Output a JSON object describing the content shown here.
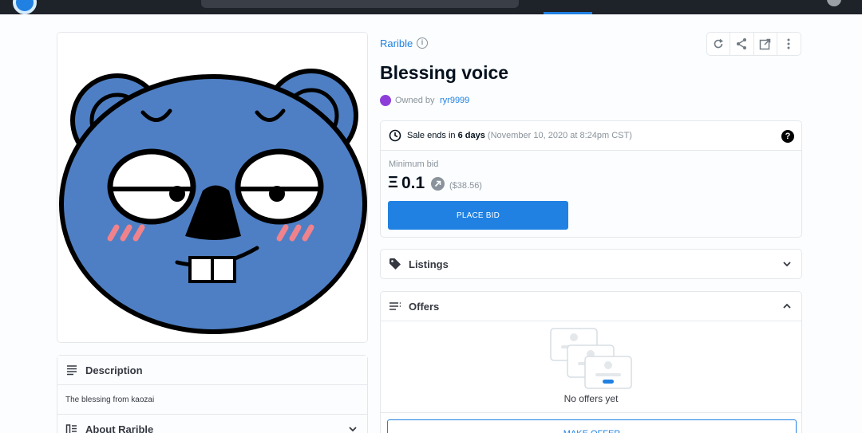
{
  "asset": {
    "collection": "Rarible",
    "title": "Blessing voice",
    "owned_by_label": "Owned by",
    "owner": "ryr9999"
  },
  "sale": {
    "ends_prefix": "Sale ends in",
    "ends_in": "6 days",
    "end_date": "(November 10, 2020 at 8:24pm CST)",
    "min_bid_label": "Minimum bid",
    "currency_symbol": "Ξ",
    "amount": "0.1",
    "usd": "($38.56)",
    "place_bid_label": "PLACE BID"
  },
  "listings": {
    "label": "Listings"
  },
  "offers": {
    "label": "Offers",
    "empty_text": "No offers yet",
    "make_offer_label": "MAKE OFFER"
  },
  "description": {
    "label": "Description",
    "text": "The blessing from kaozai"
  },
  "about": {
    "label": "About Rarible"
  },
  "colors": {
    "accent": "#2081e2",
    "character_blue": "#4e7fc4",
    "owner_avatar": "#8e3ed8",
    "blush": "#f0828c"
  },
  "icons": {
    "refresh": "refresh-icon",
    "share": "share-icon",
    "external": "external-link-icon",
    "more": "more-vertical-icon",
    "clock": "clock-icon",
    "help": "help-icon",
    "tag": "tag-icon",
    "list": "list-icon",
    "chevron_down": "chevron-down-icon",
    "chevron_up": "chevron-up-icon"
  }
}
